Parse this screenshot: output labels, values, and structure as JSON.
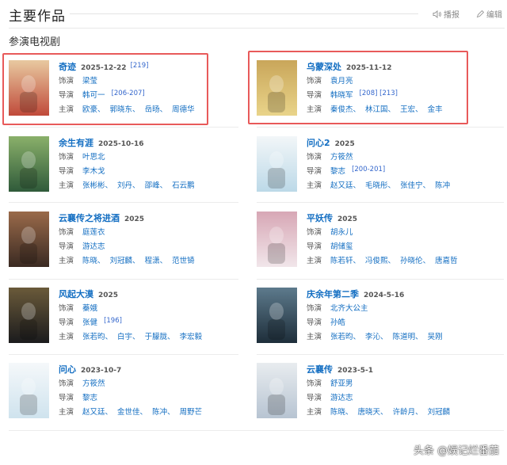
{
  "header": {
    "title": "主要作品",
    "action_report": "编辑",
    "action_share": "播报"
  },
  "section": {
    "title": "参演电视剧"
  },
  "labels": {
    "role": "饰演",
    "director": "导演",
    "cast": "主演"
  },
  "works": [
    {
      "title": "奇迹",
      "year": "2025-12-22",
      "ref": "[219]",
      "role": "梁莹",
      "directors": [
        "韩可一"
      ],
      "director_refs": "[206-207]",
      "cast": [
        "欧豪、",
        "郭晓东、",
        "岳旸、",
        "周德华"
      ],
      "poster_colors": [
        "#c04a3a",
        "#e8c9a0"
      ]
    },
    {
      "title": "乌蒙深处",
      "year": "2025-11-12",
      "ref": "",
      "role": "袁月亮",
      "directors": [
        "韩晓军"
      ],
      "director_refs": "[208]  [213]",
      "cast": [
        "秦俊杰、",
        "林江国、",
        "王宏、",
        "金丰"
      ],
      "poster_colors": [
        "#e9d48a",
        "#c9a65a"
      ]
    },
    {
      "title": "余生有涯",
      "year": "2025-10-16",
      "ref": "",
      "role": "叶思北",
      "directors": [
        "李木戈"
      ],
      "director_refs": "",
      "cast": [
        "张彬彬、",
        "刘丹、",
        "邵峰、",
        "石云鹏"
      ],
      "poster_colors": [
        "#2f5a3a",
        "#8ab06a"
      ]
    },
    {
      "title": "问心2",
      "year": "2025",
      "ref": "",
      "role": "方筱然",
      "directors": [
        "黎志"
      ],
      "director_refs": "[200-201]",
      "cast": [
        "赵又廷、",
        "毛晓彤、",
        "张佳宁、",
        "陈冲"
      ],
      "poster_colors": [
        "#bcd9e8",
        "#f2f6f8"
      ]
    },
    {
      "title": "云襄传之将进酒",
      "year": "2025",
      "ref": "",
      "role": "庭莲衣",
      "directors": [
        "游达志"
      ],
      "director_refs": "",
      "cast": [
        "陈晓、",
        "刘冠麟、",
        "程潇、",
        "范世锜"
      ],
      "poster_colors": [
        "#3a2a22",
        "#9a6a4a"
      ]
    },
    {
      "title": "平妖传",
      "year": "2025",
      "ref": "",
      "role": "胡永儿",
      "directors": [
        "胡储玺"
      ],
      "director_refs": "",
      "cast": [
        "陈若轩、",
        "冯俊熙、",
        "孙晓伦、",
        "唐嘉哲"
      ],
      "poster_colors": [
        "#f1e6ea",
        "#d7a7b5"
      ]
    },
    {
      "title": "风起大漠",
      "year": "2025",
      "ref": "",
      "role": "蓁娥",
      "directors": [
        "张健"
      ],
      "director_refs": "[196]",
      "cast": [
        "张若昀、",
        "白宇、",
        "于朦胧、",
        "李宏毅"
      ],
      "poster_colors": [
        "#1b1b1d",
        "#6a5a3a"
      ]
    },
    {
      "title": "庆余年第二季",
      "year": "2024-5-16",
      "ref": "",
      "role": "北齐大公主",
      "directors": [
        "孙皓"
      ],
      "director_refs": "",
      "cast": [
        "张若昀、",
        "李沁、",
        "陈道明、",
        "吴刚"
      ],
      "poster_colors": [
        "#1e2e3a",
        "#5d7a8c"
      ]
    },
    {
      "title": "问心",
      "year": "2023-10-7",
      "ref": "",
      "role": "方筱然",
      "directors": [
        "黎志"
      ],
      "director_refs": "",
      "cast": [
        "赵又廷、",
        "金世佳、",
        "陈冲、",
        "周野芒"
      ],
      "poster_colors": [
        "#cfe3ee",
        "#f5f8fa"
      ]
    },
    {
      "title": "云襄传",
      "year": "2023-5-1",
      "ref": "",
      "role": "舒亚男",
      "directors": [
        "游达志"
      ],
      "director_refs": "",
      "cast": [
        "陈晓、",
        "唐晓天、",
        "许龄月、",
        "刘冠麟"
      ],
      "poster_colors": [
        "#b7c4d2",
        "#e8ecef"
      ]
    }
  ],
  "watermark": {
    "platform": "头条",
    "account": "@娱记烂番茄"
  },
  "colors": {
    "link": "#136ec2",
    "highlight": "#e85a5a"
  }
}
